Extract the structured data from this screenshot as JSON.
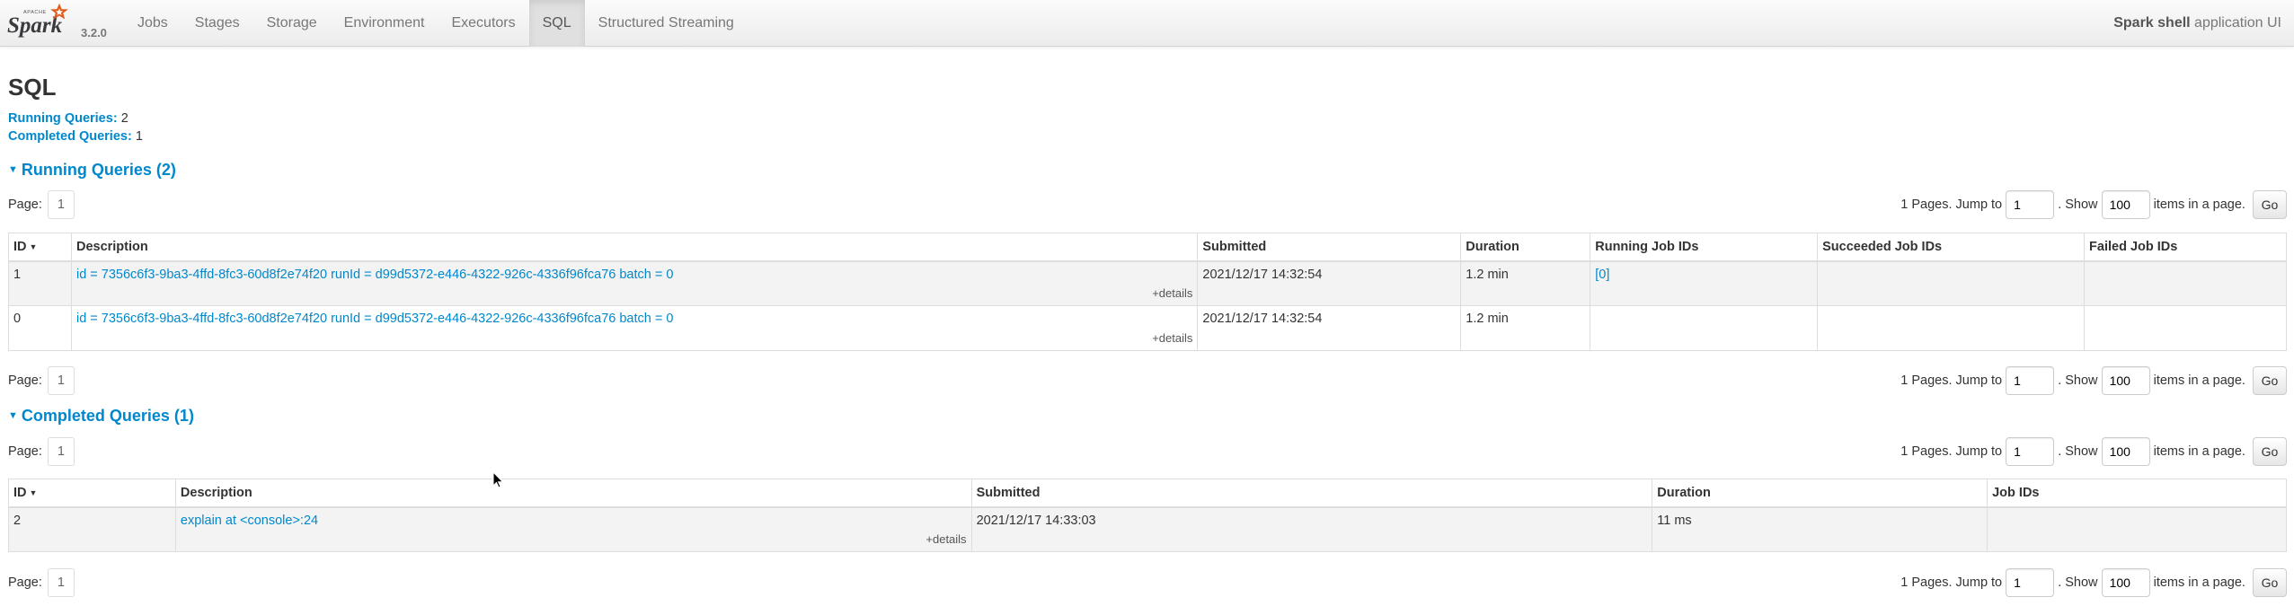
{
  "navbar": {
    "logo_text": "Spark",
    "logo_tagline": "APACHE",
    "version": "3.2.0",
    "tabs": [
      {
        "label": "Jobs",
        "active": false
      },
      {
        "label": "Stages",
        "active": false
      },
      {
        "label": "Storage",
        "active": false
      },
      {
        "label": "Environment",
        "active": false
      },
      {
        "label": "Executors",
        "active": false
      },
      {
        "label": "SQL",
        "active": true
      },
      {
        "label": "Structured Streaming",
        "active": false
      }
    ],
    "app_name": "Spark shell",
    "app_suffix": " application UI"
  },
  "page": {
    "title": "SQL",
    "running_label": "Running Queries:",
    "running_count": "2",
    "completed_label": "Completed Queries:",
    "completed_count": "1"
  },
  "pager": {
    "page_label": "Page:",
    "page_value": "1",
    "pages_text": "1 Pages. Jump to",
    "jump_value": "1",
    "show_text": ". Show",
    "show_value": "100",
    "items_text": "items in a page.",
    "go_label": "Go"
  },
  "running": {
    "title": "Running Queries (2)",
    "headers": [
      "ID",
      "Description",
      "Submitted",
      "Duration",
      "Running Job IDs",
      "Succeeded Job IDs",
      "Failed Job IDs"
    ],
    "rows": [
      {
        "id": "1",
        "description": "id = 7356c6f3-9ba3-4ffd-8fc3-60d8f2e74f20 runId = d99d5372-e446-4322-926c-4336f96fca76 batch = 0",
        "details": "+details",
        "submitted": "2021/12/17 14:32:54",
        "duration": "1.2 min",
        "running": "[0]",
        "succeeded": "",
        "failed": ""
      },
      {
        "id": "0",
        "description": "id = 7356c6f3-9ba3-4ffd-8fc3-60d8f2e74f20 runId = d99d5372-e446-4322-926c-4336f96fca76 batch = 0",
        "details": "+details",
        "submitted": "2021/12/17 14:32:54",
        "duration": "1.2 min",
        "running": "",
        "succeeded": "",
        "failed": ""
      }
    ]
  },
  "completed": {
    "title": "Completed Queries (1)",
    "headers": [
      "ID",
      "Description",
      "Submitted",
      "Duration",
      "Job IDs"
    ],
    "rows": [
      {
        "id": "2",
        "description": "explain at <console>:24",
        "details": "+details",
        "submitted": "2021/12/17 14:33:03",
        "duration": "11 ms",
        "jobs": ""
      }
    ]
  },
  "colors": {
    "link": "#0088cc",
    "logo_orange": "#e25a1c",
    "row_stripe": "#f3f3f3"
  }
}
